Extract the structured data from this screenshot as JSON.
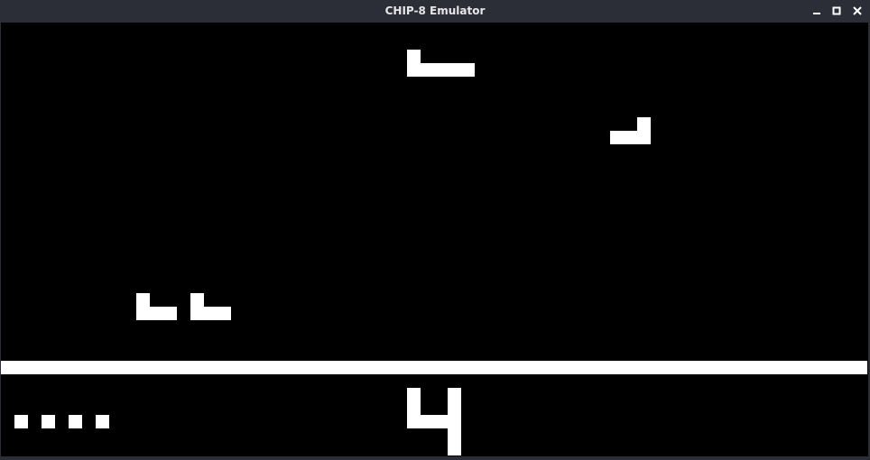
{
  "window": {
    "title": "CHIP-8 Emulator",
    "buttons": {
      "minimize_icon": "minimize-icon",
      "maximize_icon": "maximize-icon",
      "close_icon": "close-icon"
    }
  },
  "colors": {
    "titlebar_bg": "#2b2e37",
    "title_text": "#e6e6e6",
    "screen_bg": "#000000",
    "pixel_on": "#ffffff"
  },
  "display": {
    "resolution": "64x32",
    "sprites": [
      {
        "name": "enemy-sprite-top",
        "cells": [
          [
            30,
            2
          ],
          [
            30,
            3
          ],
          [
            31,
            3
          ],
          [
            32,
            3
          ],
          [
            33,
            3
          ],
          [
            34,
            3
          ]
        ]
      },
      {
        "name": "enemy-sprite-right",
        "cells": [
          [
            47,
            7
          ],
          [
            45,
            8
          ],
          [
            46,
            8
          ],
          [
            47,
            8
          ]
        ]
      },
      {
        "name": "player-sprite-left",
        "cells": [
          [
            10,
            20
          ],
          [
            10,
            21
          ],
          [
            11,
            21
          ],
          [
            12,
            21
          ]
        ]
      },
      {
        "name": "player-sprite-right",
        "cells": [
          [
            14,
            20
          ],
          [
            14,
            21
          ],
          [
            15,
            21
          ],
          [
            16,
            21
          ]
        ]
      },
      {
        "name": "ground-line",
        "cells": [
          [
            0,
            25
          ],
          [
            1,
            25
          ],
          [
            2,
            25
          ],
          [
            3,
            25
          ],
          [
            4,
            25
          ],
          [
            5,
            25
          ],
          [
            6,
            25
          ],
          [
            7,
            25
          ],
          [
            8,
            25
          ],
          [
            9,
            25
          ],
          [
            10,
            25
          ],
          [
            11,
            25
          ],
          [
            12,
            25
          ],
          [
            13,
            25
          ],
          [
            14,
            25
          ],
          [
            15,
            25
          ],
          [
            16,
            25
          ],
          [
            17,
            25
          ],
          [
            18,
            25
          ],
          [
            19,
            25
          ],
          [
            20,
            25
          ],
          [
            21,
            25
          ],
          [
            22,
            25
          ],
          [
            23,
            25
          ],
          [
            24,
            25
          ],
          [
            25,
            25
          ],
          [
            26,
            25
          ],
          [
            27,
            25
          ],
          [
            28,
            25
          ],
          [
            29,
            25
          ],
          [
            30,
            25
          ],
          [
            31,
            25
          ],
          [
            32,
            25
          ],
          [
            33,
            25
          ],
          [
            34,
            25
          ],
          [
            35,
            25
          ],
          [
            36,
            25
          ],
          [
            37,
            25
          ],
          [
            38,
            25
          ],
          [
            39,
            25
          ],
          [
            40,
            25
          ],
          [
            41,
            25
          ],
          [
            42,
            25
          ],
          [
            43,
            25
          ],
          [
            44,
            25
          ],
          [
            45,
            25
          ],
          [
            46,
            25
          ],
          [
            47,
            25
          ],
          [
            48,
            25
          ],
          [
            49,
            25
          ],
          [
            50,
            25
          ],
          [
            51,
            25
          ],
          [
            52,
            25
          ],
          [
            53,
            25
          ],
          [
            54,
            25
          ],
          [
            55,
            25
          ],
          [
            56,
            25
          ],
          [
            57,
            25
          ],
          [
            58,
            25
          ],
          [
            59,
            25
          ],
          [
            60,
            25
          ],
          [
            61,
            25
          ],
          [
            62,
            25
          ],
          [
            63,
            25
          ]
        ]
      },
      {
        "name": "lives-dots",
        "cells": [
          [
            1,
            29
          ],
          [
            3,
            29
          ],
          [
            5,
            29
          ],
          [
            7,
            29
          ]
        ]
      },
      {
        "name": "score-digit-4",
        "cells": [
          [
            30,
            27
          ],
          [
            33,
            27
          ],
          [
            30,
            28
          ],
          [
            33,
            28
          ],
          [
            30,
            29
          ],
          [
            31,
            29
          ],
          [
            32,
            29
          ],
          [
            33,
            29
          ],
          [
            33,
            30
          ],
          [
            33,
            31
          ]
        ]
      }
    ]
  }
}
